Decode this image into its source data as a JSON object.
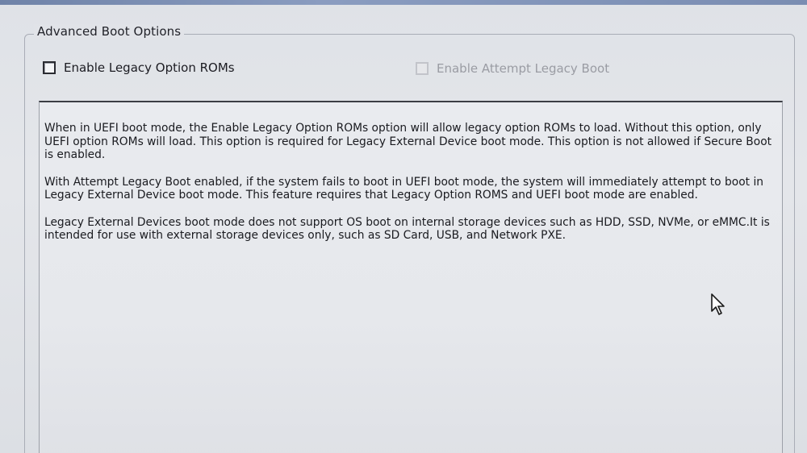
{
  "group": {
    "title": "Advanced Boot Options"
  },
  "options": {
    "legacy_roms": {
      "label": "Enable Legacy Option ROMs",
      "checked": false,
      "enabled": true
    },
    "attempt_legacy": {
      "label": "Enable Attempt Legacy Boot",
      "checked": false,
      "enabled": false
    }
  },
  "description": {
    "paragraphs": [
      "When in UEFI boot mode, the Enable Legacy Option ROMs option will allow legacy option ROMs to load. Without this option, only UEFI option ROMs will load. This option is required for Legacy External Device boot mode. This option is not allowed if Secure Boot is enabled.",
      "With Attempt Legacy Boot enabled, if the system fails to boot in UEFI boot mode, the system will immediately attempt to boot in Legacy External Device boot mode. This feature requires that Legacy Option ROMS and UEFI boot mode are enabled.",
      "Legacy External Devices boot mode does not support OS boot on internal storage devices such as HDD, SSD, NVMe, or eMMC.It is intended for use with external storage devices only, such as SD Card, USB, and Network PXE."
    ]
  },
  "colors": {
    "top_strip": "#7a8db2",
    "background": "#e1e3e8",
    "disabled_text": "#9a9ca3"
  },
  "icons": {
    "cursor": "mouse-pointer-icon"
  }
}
